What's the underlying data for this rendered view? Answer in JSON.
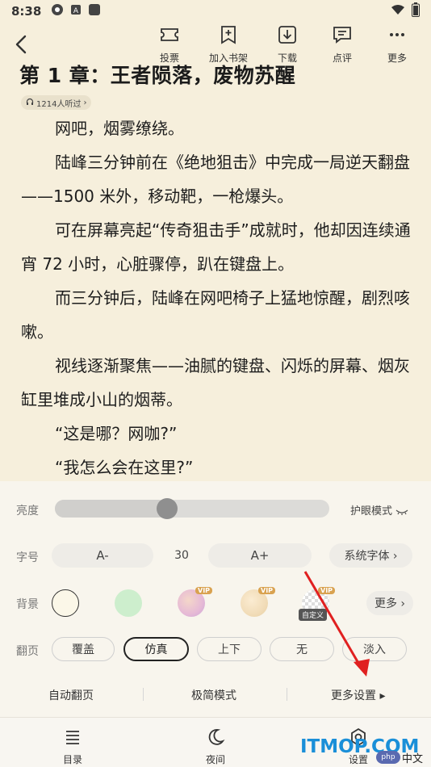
{
  "status_bar": {
    "time": "8:38",
    "icons": [
      "chrome-icon",
      "a-icon",
      "square-icon",
      "wifi-icon",
      "battery-icon"
    ]
  },
  "toolbar": {
    "back_icon": "chevron-left-icon",
    "items": [
      {
        "label": "投票",
        "icon": "ticket-icon"
      },
      {
        "label": "加入书架",
        "icon": "bookmark-plus-icon"
      },
      {
        "label": "下载",
        "icon": "download-icon"
      },
      {
        "label": "点评",
        "icon": "comment-icon"
      },
      {
        "label": "更多",
        "icon": "more-icon"
      }
    ]
  },
  "content": {
    "chapter_title": "第 1 章：王者陨落，废物苏醒",
    "listen_count": "1214人听过",
    "paragraphs": [
      "网吧，烟雾缭绕。",
      "陆峰三分钟前在《绝地狙击》中完成一局逆天翻盘——1500 米外，移动靶，一枪爆头。",
      "可在屏幕亮起“传奇狙击手”成就时，他却因连续通宵 72 小时，心脏骤停，趴在键盘上。",
      "而三分钟后，陆峰在网吧椅子上猛地惊醒，剧烈咳嗽。",
      "视线逐渐聚焦——油腻的键盘、闪烁的屏幕、烟灰缸里堆成小山的烟蒂。",
      "“这是哪？网咖?”",
      "“我怎么会在这里?”"
    ]
  },
  "settings": {
    "brightness": {
      "label": "亮度",
      "value": 0.41,
      "eye_mode": "护眼模式"
    },
    "font": {
      "label": "字号",
      "decrease": "A-",
      "size": "30",
      "increase": "A+",
      "typeface": "系统字体 ›"
    },
    "background": {
      "label": "背景",
      "swatches": [
        {
          "color": "#fbf7e8",
          "selected": true
        },
        {
          "color": "#cfeecf"
        },
        {
          "vip": "VIP"
        },
        {
          "vip": "VIP"
        },
        {
          "vip": "VIP",
          "caption": "自定义"
        }
      ],
      "more": "更多 ›"
    },
    "page_turn": {
      "label": "翻页",
      "options": [
        "覆盖",
        "仿真",
        "上下",
        "无",
        "淡入"
      ],
      "selected": "仿真"
    },
    "options": {
      "auto_turn": "自动翻页",
      "minimal": "极简模式",
      "more_settings": "更多设置 ▸"
    }
  },
  "bottom_nav": [
    {
      "label": "目录",
      "icon": "list-icon"
    },
    {
      "label": "夜间",
      "icon": "moon-icon"
    },
    {
      "label": "设置",
      "icon": "gear-icon"
    }
  ],
  "watermark": {
    "text": "ITMOP.COM",
    "badge": "php",
    "suffix": "中文网"
  }
}
